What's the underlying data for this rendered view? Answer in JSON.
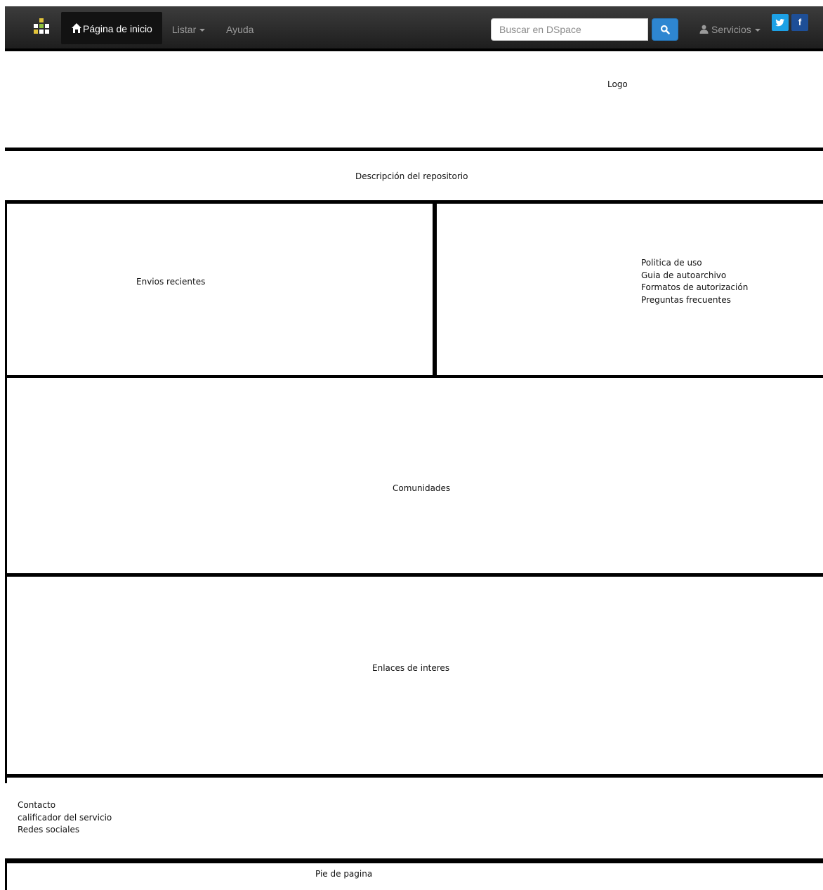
{
  "navbar": {
    "brand_icon": "dspace-logo-icon",
    "home_label": "Página de inicio",
    "home_icon": "home-icon",
    "browse_label": "Listar",
    "help_label": "Ayuda",
    "search_placeholder": "Buscar en DSpace",
    "search_icon": "search-icon",
    "services_label": "Servicios",
    "user_icon": "user-icon",
    "twitter_glyph": "",
    "facebook_glyph": "f",
    "colors": {
      "navbar_bg": "#2b2b2b",
      "search_button": "#2e86d1",
      "twitter": "#1da1e6",
      "facebook": "#1e4f97"
    }
  },
  "wireframe": {
    "logo": "Logo",
    "description": "Descripción del repositorio",
    "recent": "Envios recientes",
    "info_links": [
      "Politica de uso",
      "Guia de autoarchivo",
      "Formatos de autorización",
      "Preguntas frecuentes"
    ],
    "communities": "Comunidades",
    "links": "Enlaces de interes",
    "contact_items": [
      "Contacto",
      "calificador del servicio",
      "Redes sociales"
    ],
    "footer": "Pie de pagina"
  }
}
